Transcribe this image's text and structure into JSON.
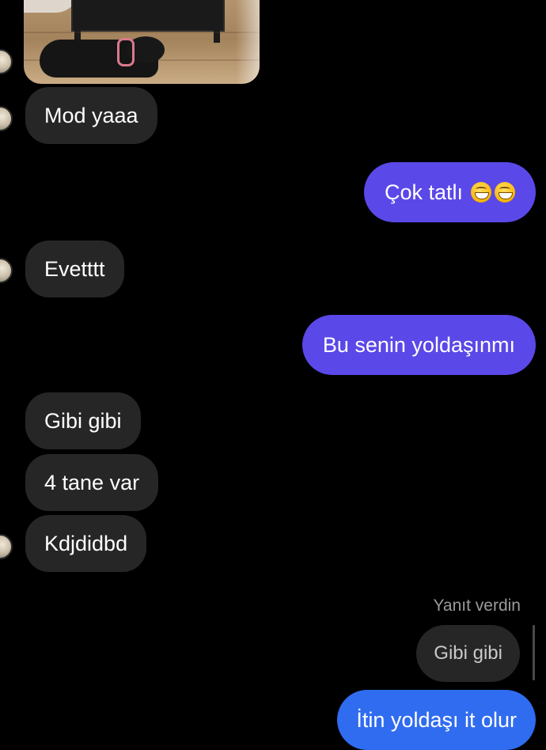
{
  "conversation": {
    "shared_image": {
      "description_label": "shared-photo"
    },
    "messages": [
      {
        "id": "m1",
        "direction": "incoming",
        "text": "Mod yaaa"
      },
      {
        "id": "m2",
        "direction": "outgoing",
        "text": "Çok tatlı",
        "emoji": "grinning-face-with-smiling-eyes",
        "emoji_count": 2
      },
      {
        "id": "m3",
        "direction": "incoming",
        "text": "Evetttt"
      },
      {
        "id": "m4",
        "direction": "outgoing",
        "text": "Bu senin yoldaşınmı"
      },
      {
        "id": "m5",
        "direction": "incoming",
        "text": "Gibi gibi"
      },
      {
        "id": "m6",
        "direction": "incoming",
        "text": "4 tane var"
      },
      {
        "id": "m7",
        "direction": "incoming",
        "text": "Kdjdidbd"
      },
      {
        "id": "m8",
        "direction": "outgoing",
        "text": "İtin yoldaşı it olur"
      }
    ],
    "reply": {
      "label": "Yanıt verdin",
      "quoted_text": "Gibi gibi"
    }
  },
  "colors": {
    "background": "#000000",
    "incoming_bubble": "#262626",
    "outgoing_purple": "#5b48e8",
    "outgoing_blue": "#2f6cf0",
    "reply_label": "#9a9a9a"
  }
}
